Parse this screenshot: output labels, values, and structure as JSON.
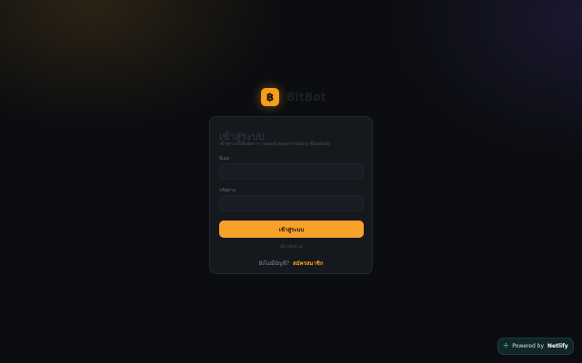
{
  "brand": {
    "logo_glyph": "฿",
    "name": "BitBot",
    "accent_color": "#f59e1c"
  },
  "login": {
    "title": "เข้าสู่ระบบ",
    "subtitle": "เข้าสู่ระบบเพื่อจัดการ กลยุทธ์ paper trading ที่ปลอดภัย",
    "email_label": "อีเมล",
    "email_placeholder": "",
    "password_label": "รหัสผ่าน",
    "password_placeholder": "",
    "submit_label": "เข้าสู่ระบบ",
    "forgot_label": "ลืมรหัสผ่าน",
    "signup_prompt": "ยังไม่มีบัญชี?",
    "signup_link": "สมัครสมาชิก"
  },
  "netlify_badge": {
    "icon": "netlify-icon",
    "prefix": "Powered by",
    "brand": "Netlify"
  }
}
